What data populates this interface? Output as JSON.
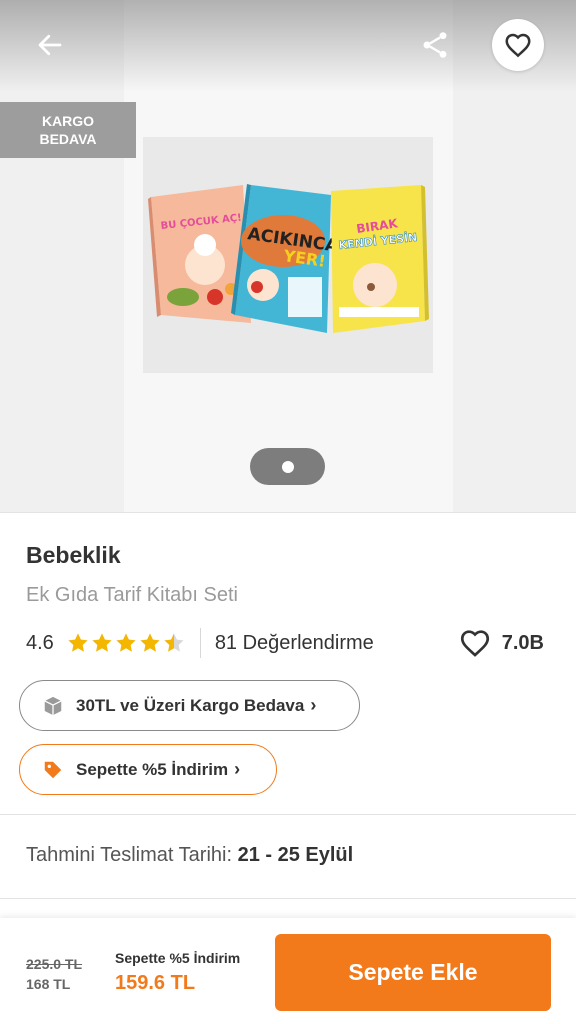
{
  "gallery": {
    "badge_line1": "KARGO",
    "badge_line2": "BEDAVA",
    "book1_title": "BU ÇOCUK AÇ!",
    "book2_title_1": "ACIKINCA",
    "book2_title_2": "YER!",
    "book3_title_1": "BIRAK",
    "book3_title_2": "KENDİ YESİN"
  },
  "product": {
    "brand": "Bebeklik",
    "name": "Ek Gıda Tarif Kitabı Seti",
    "rating": "4.6",
    "stars_filled": 4.5,
    "review_count": "81 Değerlendirme",
    "favorite_count": "7.0B"
  },
  "promos": {
    "cargo": "30TL ve Üzeri Kargo Bedava",
    "discount": "Sepette %5 İndirim"
  },
  "delivery": {
    "label": "Tahmini Teslimat Tarihi:",
    "range": "21 - 25 Eylül"
  },
  "price": {
    "old": "225.0 TL",
    "list": "168 TL",
    "promo_label": "Sepette %5 İndirim",
    "promo_price": "159.6 TL",
    "add_to_cart": "Sepete Ekle"
  },
  "icons": {
    "back": "arrow-left-icon",
    "share": "share-icon",
    "favorite": "heart-outline-icon",
    "cargo": "box-icon",
    "discount": "tag-icon"
  },
  "colors": {
    "accent": "#f27a1a",
    "star": "#f5b600",
    "badge_bg": "#9d9d9d"
  }
}
